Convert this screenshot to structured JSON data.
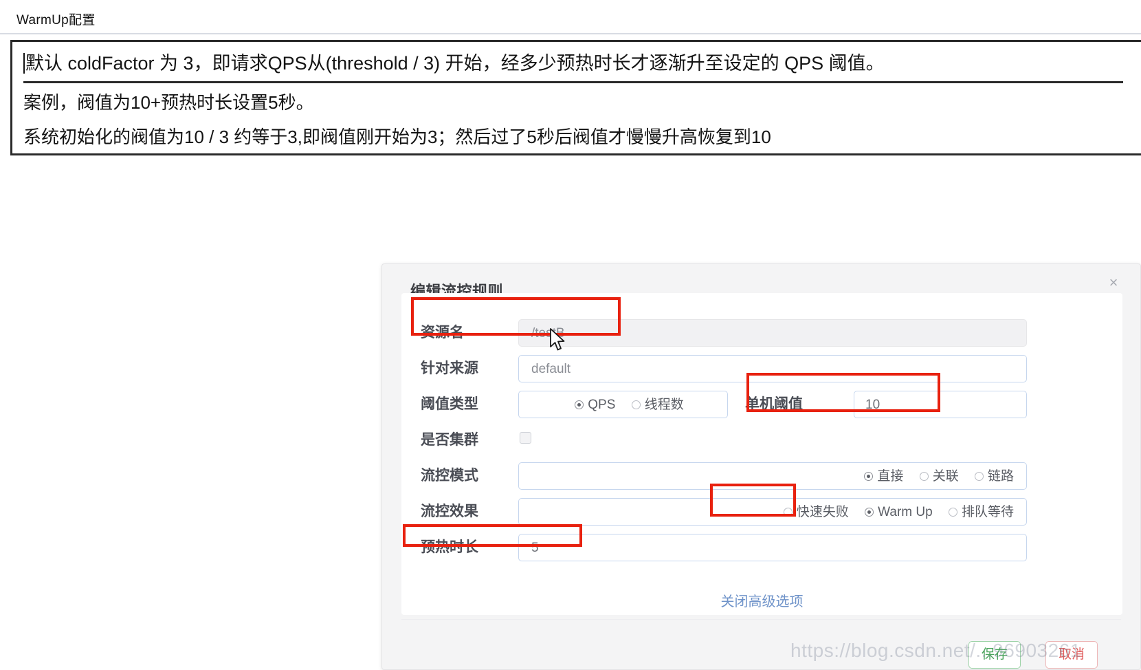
{
  "note": {
    "title": "WarmUp配置",
    "line1": "默认 coldFactor 为 3，即请求QPS从(threshold / 3) 开始，经多少预热时长才逐渐升至设定的 QPS 阈值。",
    "line2": "案例，阀值为10+预热时长设置5秒。",
    "line3": "系统初始化的阀值为10 / 3 约等于3,即阀值刚开始为3；然后过了5秒后阀值才慢慢升高恢复到10"
  },
  "dialog": {
    "title": "编辑流控规则",
    "close_icon": "×",
    "fields": {
      "resource": {
        "label": "资源名",
        "value": "/testB"
      },
      "origin": {
        "label": "针对来源",
        "value": "default"
      },
      "threshold_type": {
        "label": "阈值类型",
        "options": [
          {
            "label": "QPS",
            "selected": true
          },
          {
            "label": "线程数",
            "selected": false
          }
        ]
      },
      "single_threshold": {
        "label": "单机阈值",
        "value": "10"
      },
      "cluster": {
        "label": "是否集群",
        "checked": false
      },
      "flow_mode": {
        "label": "流控模式",
        "options": [
          {
            "label": "直接",
            "selected": true
          },
          {
            "label": "关联",
            "selected": false
          },
          {
            "label": "链路",
            "selected": false
          }
        ]
      },
      "flow_effect": {
        "label": "流控效果",
        "options": [
          {
            "label": "快速失败",
            "selected": false
          },
          {
            "label": "Warm Up",
            "selected": true
          },
          {
            "label": "排队等待",
            "selected": false
          }
        ]
      },
      "warmup_duration": {
        "label": "预热时长",
        "value": "5"
      }
    },
    "advanced_link": "关闭高级选项",
    "buttons": {
      "save": "保存",
      "cancel": "取消"
    }
  },
  "watermark": "https://blog.csdn.net/...96903261",
  "colors": {
    "annotation": "#e8210f",
    "link": "#6f93c9",
    "save": "#4aa45c",
    "cancel": "#e05c5c"
  }
}
